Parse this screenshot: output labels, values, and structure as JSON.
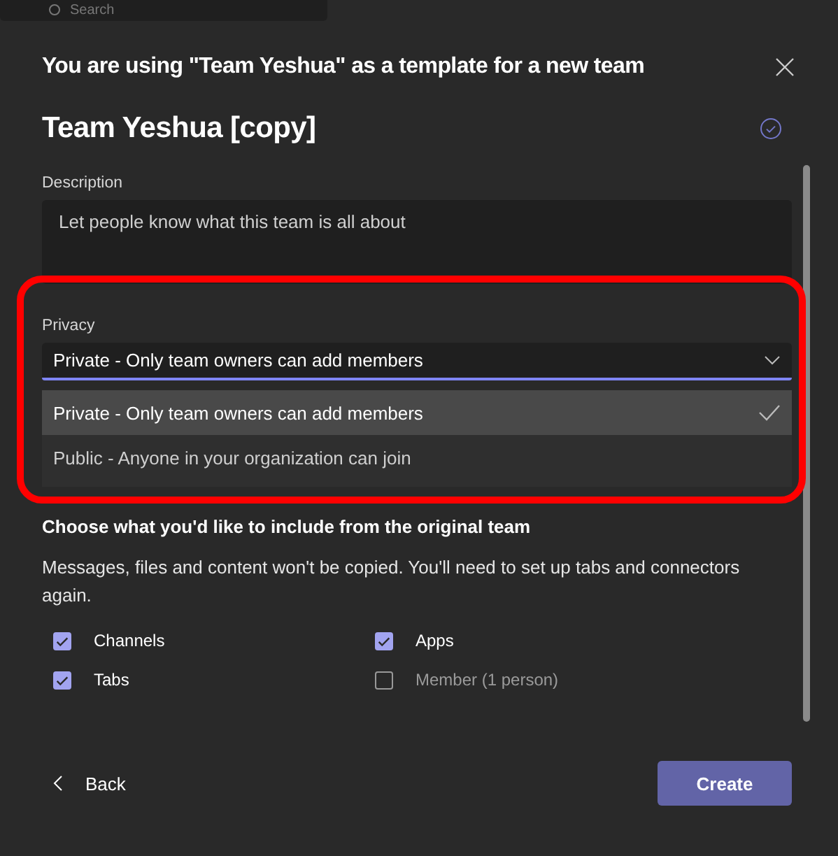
{
  "top_bar": {
    "search_placeholder": "Search"
  },
  "dialog": {
    "title": "You are using \"Team Yeshua\" as a template for a new team",
    "team_name": "Team Yeshua [copy]",
    "description": {
      "label": "Description",
      "placeholder": "Let people know what this team is all about"
    },
    "privacy": {
      "label": "Privacy",
      "value": "Private - Only team owners can add members",
      "expanded": true,
      "highlighted": true,
      "options": [
        {
          "label": "Private - Only team owners can add members",
          "selected": true
        },
        {
          "label": "Public - Anyone in your organization can join",
          "selected": false
        }
      ]
    },
    "include": {
      "heading": "Choose what you'd like to include from the original team",
      "note": "Messages, files and content won't be copied. You'll need to set up tabs and connectors again.",
      "options": [
        {
          "label": "Channels",
          "checked": true,
          "disabled": false
        },
        {
          "label": "Apps",
          "checked": true,
          "disabled": false
        },
        {
          "label": "Tabs",
          "checked": true,
          "disabled": false
        },
        {
          "label": "Member (1 person)",
          "checked": false,
          "disabled": true
        }
      ]
    },
    "back_button": "Back",
    "create_button": "Create"
  }
}
